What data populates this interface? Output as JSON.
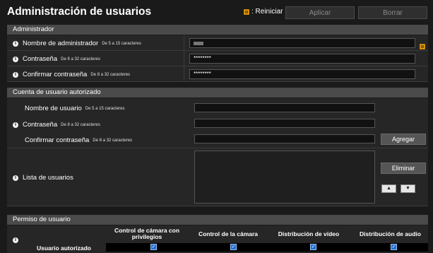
{
  "header": {
    "title": "Administración de usuarios",
    "reset_label": ": Reiniciar",
    "apply_label": "Aplicar",
    "delete_label": "Borrar"
  },
  "admin": {
    "section_title": "Administrador",
    "name_label": "Nombre de administrador",
    "name_hint": "De 5 a 15 caracteres",
    "password_label": "Contraseña",
    "password_hint": "De 8 a 32 caracteres",
    "password_value": "********",
    "confirm_label": "Confirmar contraseña",
    "confirm_hint": "De 8 a 32 caracteres",
    "confirm_value": "********"
  },
  "authorized": {
    "section_title": "Cuenta de usuario autorizado",
    "username_label": "Nombre de usuario",
    "username_hint": "De 5 a 15 caracteres",
    "password_label": "Contraseña",
    "password_hint": "De 8 a 32 caracteres",
    "confirm_label": "Confirmar contraseña",
    "confirm_hint": "De 8 a 32 caracteres",
    "add_button": "Agregar",
    "list_label": "Lista de usuarios",
    "remove_button": "Eliminar"
  },
  "permissions": {
    "section_title": "Permiso de usuario",
    "columns": [
      "Control de cámara con privilegios",
      "Control de la cámara",
      "Distribución de vídeo",
      "Distribución de audio"
    ],
    "row_label": "Usuario autorizado",
    "checked": [
      true,
      true,
      true,
      true
    ]
  },
  "colors": {
    "accent_orange": "#e7a20d",
    "checkbox_blue": "#1e6fd6"
  }
}
